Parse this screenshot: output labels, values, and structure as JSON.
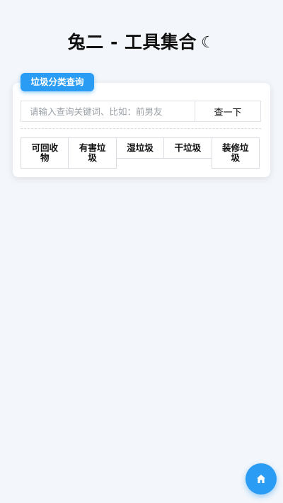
{
  "header": {
    "title": "兔二 - 工具集合",
    "theme_glyph": "☾",
    "theme_icon": "moon-icon"
  },
  "card": {
    "tag_label": "垃圾分类查询",
    "search": {
      "value": "",
      "placeholder": "请输入查询关键词、比如：前男友",
      "button_label": "查一下"
    },
    "categories": [
      {
        "label": "可回收物"
      },
      {
        "label": "有害垃圾"
      },
      {
        "label": "湿垃圾"
      },
      {
        "label": "干垃圾"
      },
      {
        "label": "装修垃圾"
      }
    ]
  },
  "fab": {
    "icon": "home-icon"
  },
  "colors": {
    "accent": "#2b9cf4",
    "background": "#f3f6fa",
    "card": "#ffffff"
  }
}
